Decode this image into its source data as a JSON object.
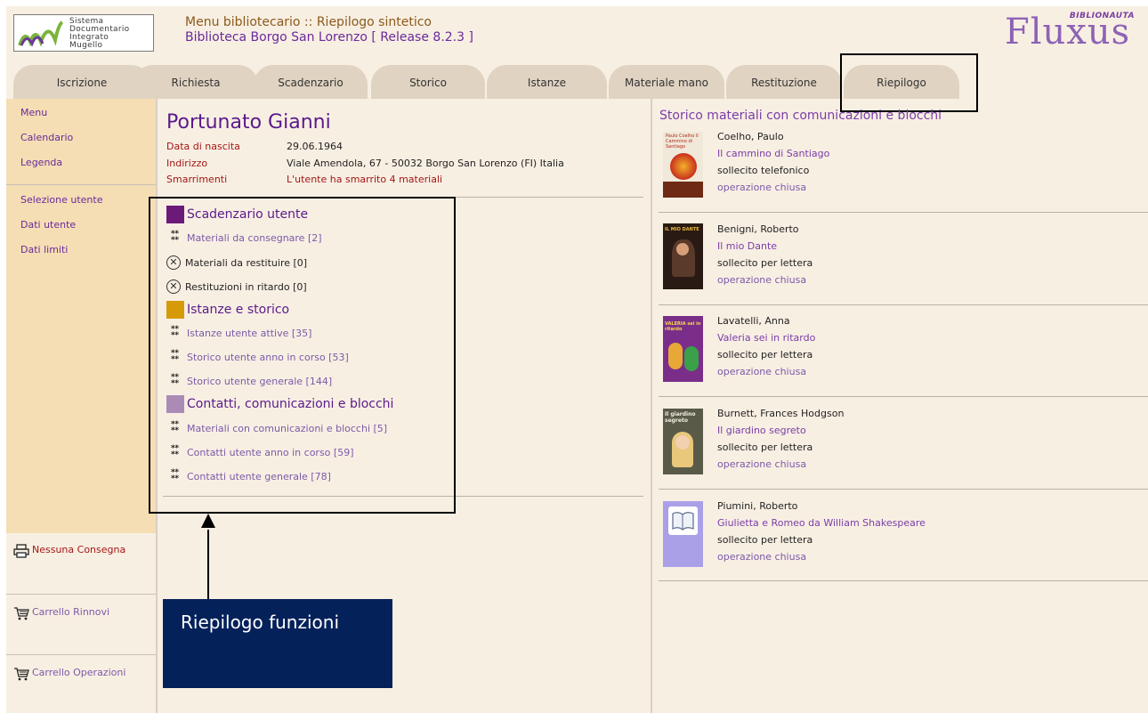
{
  "header": {
    "logo": {
      "line1": "Sistema",
      "line2": "Documentario",
      "line3": "Integrato",
      "line4": "Mugello"
    },
    "title_line1": "Menu bibliotecario :: Riepilogo sintetico",
    "title_line2": "Biblioteca Borgo San Lorenzo [ Release 8.2.3 ]",
    "brand_sub": "BIBLIONAUTA",
    "brand_name": "Fluxus"
  },
  "tabs": [
    "Iscrizione",
    "Richiesta",
    "Scadenzario",
    "Storico",
    "Istanze",
    "Materiale mano",
    "Restituzione",
    "Riepilogo"
  ],
  "sidebar": {
    "top_links": [
      "Menu",
      "Calendario",
      "Legenda"
    ],
    "user_links": [
      "Selezione utente",
      "Dati utente",
      "Dati limiti"
    ],
    "actions": {
      "consegna": "Nessuna Consegna",
      "rinnovi": "Carrello Rinnovi",
      "operazioni": "Carrello Operazioni"
    }
  },
  "user": {
    "name": "Portunato Gianni",
    "birth_label": "Data di nascita",
    "birth_value": "29.06.1964",
    "address_label": "Indirizzo",
    "address_value": "Viale Amendola, 67 - 50032 Borgo San Lorenzo (FI) Italia",
    "lost_label": "Smarrimenti",
    "lost_value": "L'utente ha smarrito 4 materiali"
  },
  "sections": {
    "scadenzario": {
      "title": "Scadenzario utente",
      "color": "#6b1a7a",
      "items": [
        "Materiali da consegnare [2]",
        "Materiali da restituire [0]",
        "Restituzioni in ritardo [0]"
      ]
    },
    "istanze": {
      "title": "Istanze e storico",
      "color": "#d69a08",
      "items": [
        "Istanze utente attive [35]",
        "Storico utente anno in corso [53]",
        "Storico utente generale [144]"
      ]
    },
    "contatti": {
      "title": "Contatti, comunicazioni e blocchi",
      "color": "#a98bb6",
      "items": [
        "Materiali con comunicazioni e blocchi [5]",
        "Contatti utente anno in corso [59]",
        "Contatti utente generale [78]"
      ]
    }
  },
  "callout": "Riepilogo funzioni",
  "history": {
    "title": "Storico materiali con comunicazioni e blocchi",
    "records": [
      {
        "author": "Coelho, Paulo",
        "title": "Il cammino di Santiago",
        "status": "sollecito telefonico",
        "op": "operazione chiusa",
        "cover_text": "Paulo Coelho Il Cammino di Santiago"
      },
      {
        "author": "Benigni, Roberto",
        "title": "Il mio Dante",
        "status": "sollecito per lettera",
        "op": "operazione chiusa",
        "cover_text": "IL MIO DANTE"
      },
      {
        "author": "Lavatelli, Anna",
        "title": "Valeria sei in ritardo",
        "status": "sollecito per lettera",
        "op": "operazione chiusa",
        "cover_text": "VALERIA sei in ritardo"
      },
      {
        "author": "Burnett, Frances Hodgson",
        "title": "Il giardino segreto",
        "status": "sollecito per lettera",
        "op": "operazione chiusa",
        "cover_text": "Il giardino segreto"
      },
      {
        "author": "Piumini, Roberto",
        "title": "Giulietta e Romeo da William Shakespeare",
        "status": "sollecito per lettera",
        "op": "operazione chiusa",
        "cover_text": ""
      }
    ]
  }
}
